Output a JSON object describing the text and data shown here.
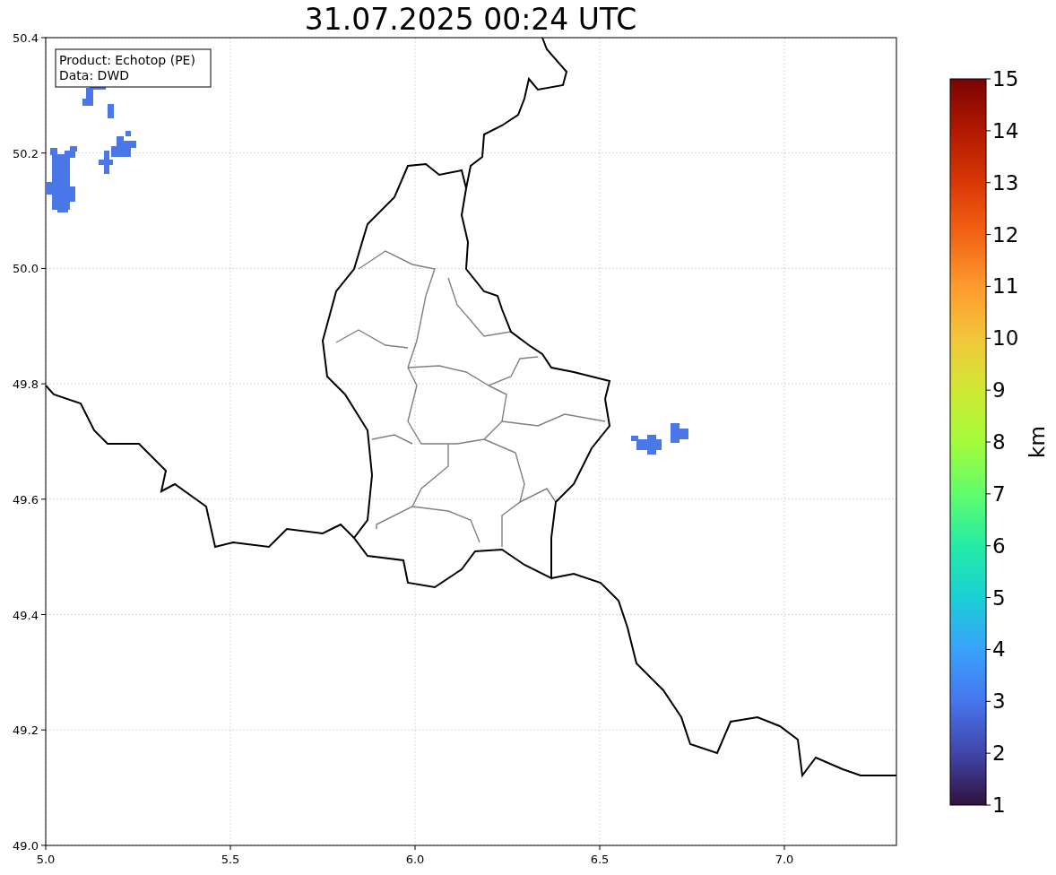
{
  "title": "31.07.2025 00:24 UTC",
  "info_box": [
    "Product: Echotop (PE)",
    "Data: DWD"
  ],
  "x_ticks": [
    "5.0",
    "5.5",
    "6.0",
    "6.5",
    "7.0"
  ],
  "y_ticks": [
    "50.4",
    "50.2",
    "50.0",
    "49.8",
    "49.6",
    "49.4",
    "49.2",
    "49.0"
  ],
  "colorbar": {
    "ticks": [
      "15",
      "14",
      "13",
      "12",
      "11",
      "10",
      "9",
      "8",
      "7",
      "6",
      "5",
      "4",
      "3",
      "2",
      "1"
    ],
    "label": "km"
  }
}
